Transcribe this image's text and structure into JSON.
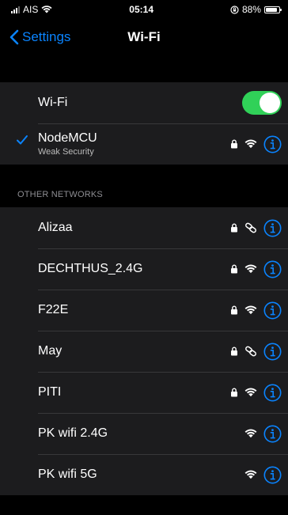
{
  "status_bar": {
    "carrier": "AIS",
    "time": "05:14",
    "battery_percent": "88%",
    "battery_level": 0.88
  },
  "nav": {
    "back_label": "Settings",
    "title": "Wi-Fi"
  },
  "wifi_toggle": {
    "label": "Wi-Fi",
    "on": true
  },
  "connected": {
    "name": "NodeMCU",
    "subtitle": "Weak Security",
    "secured": true,
    "icon": "wifi-icon"
  },
  "other_networks": {
    "header": "OTHER NETWORKS",
    "items": [
      {
        "name": "Alizaa",
        "secured": true,
        "icon": "hotspot-icon"
      },
      {
        "name": "DECHTHUS_2.4G",
        "secured": true,
        "icon": "wifi-icon"
      },
      {
        "name": "F22E",
        "secured": true,
        "icon": "wifi-icon"
      },
      {
        "name": "May",
        "secured": true,
        "icon": "hotspot-icon"
      },
      {
        "name": "PITI",
        "secured": true,
        "icon": "wifi-icon"
      },
      {
        "name": "PK wifi 2.4G",
        "secured": false,
        "icon": "wifi-icon"
      },
      {
        "name": "PK wifi 5G",
        "secured": false,
        "icon": "wifi-icon"
      }
    ]
  },
  "colors": {
    "accent": "#0a84ff",
    "toggle_on": "#30d158",
    "cell_bg": "#1c1c1e"
  }
}
